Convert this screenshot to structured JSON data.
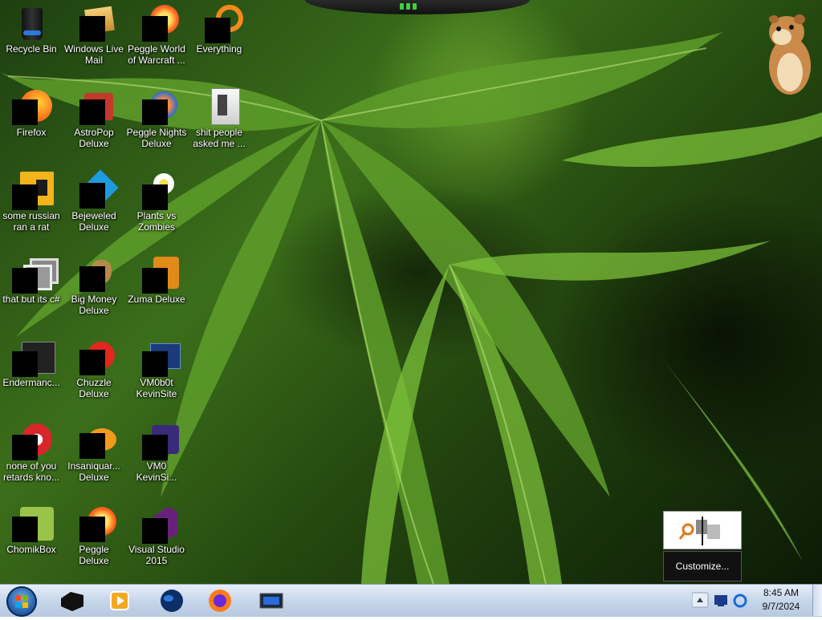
{
  "desktop_icons": [
    {
      "label": "Recycle Bin"
    },
    {
      "label": "Firefox"
    },
    {
      "label": "some russian ran a rat"
    },
    {
      "label": "that but its c#"
    },
    {
      "label": "Endermanc..."
    },
    {
      "label": "none of you retards kno..."
    },
    {
      "label": "ChomikBox"
    },
    {
      "label": "Windows Live Mail"
    },
    {
      "label": "AstroPop Deluxe"
    },
    {
      "label": "Bejeweled Deluxe"
    },
    {
      "label": "Big Money Deluxe"
    },
    {
      "label": "Chuzzle Deluxe"
    },
    {
      "label": "Insaniquar... Deluxe"
    },
    {
      "label": "Peggle Deluxe"
    },
    {
      "label": "Peggle World of Warcraft ..."
    },
    {
      "label": "Peggle Nights Deluxe"
    },
    {
      "label": "Plants vs Zombies"
    },
    {
      "label": "Zuma Deluxe"
    },
    {
      "label": "VM0b0t KevinSite"
    },
    {
      "label": "VM0 KevinSi..."
    },
    {
      "label": "Visual Studio 2015"
    },
    {
      "label": "Everything"
    },
    {
      "label": "shit people asked me ..."
    }
  ],
  "gadget": {
    "customize_label": "Customize..."
  },
  "taskbar": {
    "pinned": [
      "file-explorer-icon",
      "media-player-icon",
      "globe-icon",
      "firefox-icon",
      "screen-app-icon"
    ],
    "clock": {
      "time": "8:45 AM",
      "date": "9/7/2024"
    }
  }
}
